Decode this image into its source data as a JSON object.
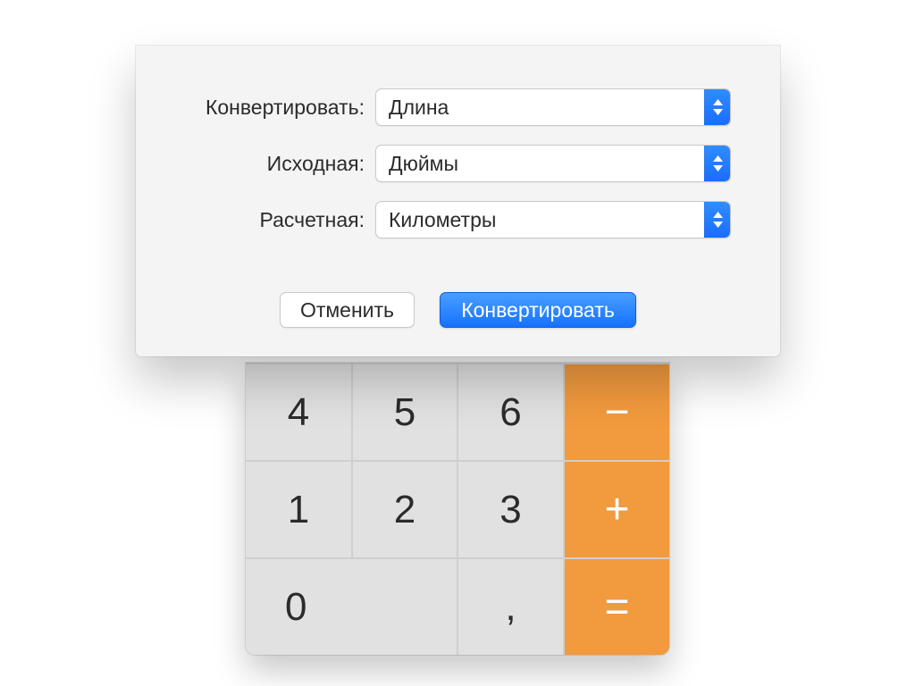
{
  "dialog": {
    "labels": {
      "convert": "Конвертировать:",
      "from": "Исходная:",
      "to": "Расчетная:"
    },
    "values": {
      "convert": "Длина",
      "from": "Дюймы",
      "to": "Километры"
    },
    "buttons": {
      "cancel": "Отменить",
      "submit": "Конвертировать"
    }
  },
  "calc": {
    "keys": {
      "k4": "4",
      "k5": "5",
      "k6": "6",
      "minus": "−",
      "k1": "1",
      "k2": "2",
      "k3": "3",
      "plus": "+",
      "k0": "0",
      "comma": ",",
      "equals": "="
    }
  }
}
